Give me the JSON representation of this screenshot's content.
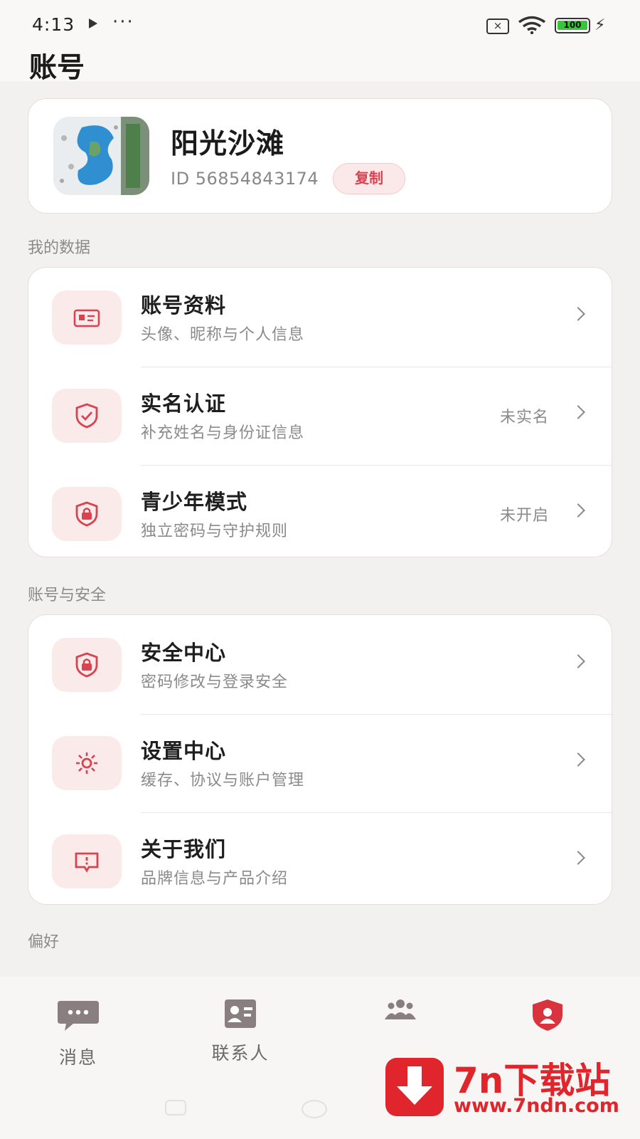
{
  "status_bar": {
    "time": "4:13",
    "dots": "···",
    "sim_icon": "sim-x-icon",
    "battery": "100"
  },
  "header": {
    "title": "账号"
  },
  "profile": {
    "name": "阳光沙滩",
    "id_text": "ID 56854843174",
    "copy_label": "复制"
  },
  "sections": {
    "data": {
      "label": "我的数据",
      "items": [
        {
          "title": "账号资料",
          "subtitle": "头像、昵称与个人信息",
          "status": "",
          "icon": "id-card-icon"
        },
        {
          "title": "实名认证",
          "subtitle": "补充姓名与身份证信息",
          "status": "未实名",
          "icon": "shield-check-icon"
        },
        {
          "title": "青少年模式",
          "subtitle": "独立密码与守护规则",
          "status": "未开启",
          "icon": "shield-lock-icon"
        }
      ]
    },
    "security": {
      "label": "账号与安全",
      "items": [
        {
          "title": "安全中心",
          "subtitle": "密码修改与登录安全",
          "status": "",
          "icon": "shield-lock-icon"
        },
        {
          "title": "设置中心",
          "subtitle": "缓存、协议与账户管理",
          "status": "",
          "icon": "gear-icon"
        },
        {
          "title": "关于我们",
          "subtitle": "品牌信息与产品介绍",
          "status": "",
          "icon": "message-info-icon"
        }
      ]
    },
    "prefs": {
      "label": "偏好"
    }
  },
  "bottom_nav": {
    "items": [
      {
        "label": "消息",
        "icon": "chat-bubble-icon"
      },
      {
        "label": "联系人",
        "icon": "contact-card-icon"
      },
      {
        "label": "",
        "icon": "group-icon"
      },
      {
        "label": "",
        "icon": "account-shield-icon"
      }
    ]
  },
  "watermark": {
    "brand": "7n下载站",
    "url": "www.7ndn.com"
  },
  "colors": {
    "accent": "#d9434f",
    "icon_bg": "#fbeaea",
    "background": "#f3f1f0"
  }
}
